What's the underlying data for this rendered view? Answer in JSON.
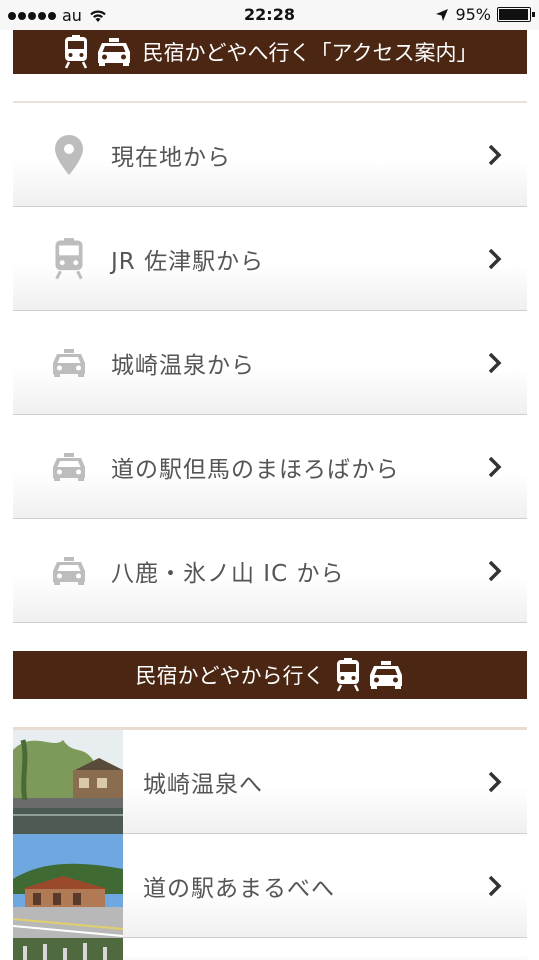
{
  "status_bar": {
    "carrier": "au",
    "time": "22:28",
    "battery_percent": "95%",
    "battery_level": 0.95
  },
  "access_banner": {
    "title": "民宿かどやへ行く「アクセス案内」",
    "icons": [
      "train-icon",
      "car-icon"
    ]
  },
  "access_items": [
    {
      "label": "現在地から",
      "icon": "location-pin-icon"
    },
    {
      "label": "JR 佐津駅から",
      "icon": "train-icon"
    },
    {
      "label": "城崎温泉から",
      "icon": "car-icon"
    },
    {
      "label": "道の駅但馬のまほろばから",
      "icon": "car-icon"
    },
    {
      "label": "八鹿・氷ノ山 IC から",
      "icon": "car-icon"
    }
  ],
  "from_banner": {
    "title": "民宿かどやから行く",
    "icons": [
      "train-icon",
      "car-icon"
    ]
  },
  "destination_items": [
    {
      "label": "城崎温泉へ",
      "thumbnail": "kinosaki-onsen-photo"
    },
    {
      "label": "道の駅あまるべへ",
      "thumbnail": "amarube-station-photo"
    },
    {
      "label": "",
      "thumbnail": "partial-photo"
    }
  ],
  "colors": {
    "banner_bg": "#4b2713",
    "icon_gray": "#bdbdbd",
    "text": "#555555",
    "chevron": "#333333"
  }
}
